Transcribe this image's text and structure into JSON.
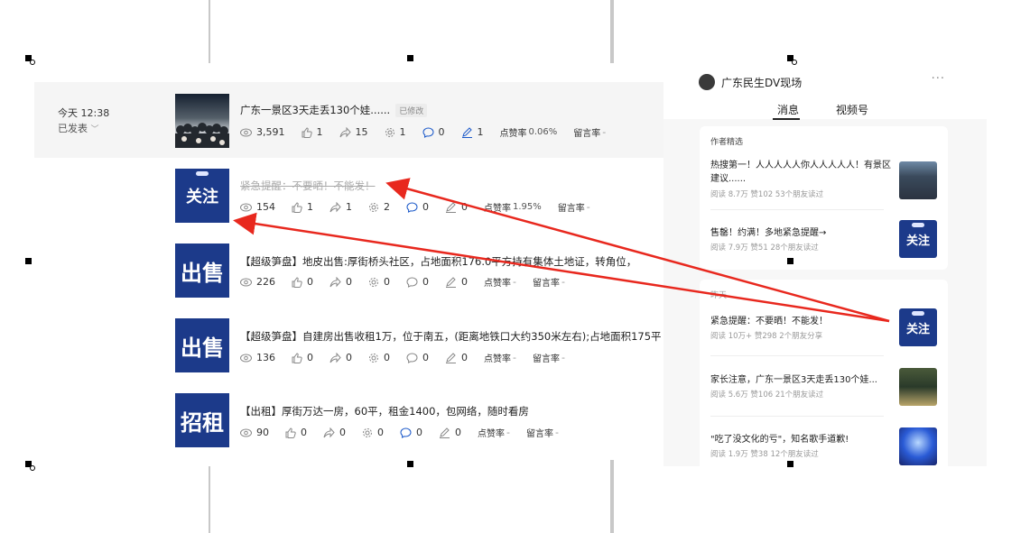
{
  "left": {
    "date": {
      "time": "今天 12:38",
      "status": "已发表"
    },
    "rows": [
      {
        "title": "广东一景区3天走丢130个娃......",
        "tag": "已修改",
        "views": "3,591",
        "likes": "1",
        "shares": "15",
        "recs": "1",
        "comments": "0",
        "edits": "1",
        "ctr_label": "点赞率",
        "ctr": "0.06%",
        "msg_label": "留言率",
        "msg": "-"
      },
      {
        "title": "紧急提醒：不要晒！不能发！",
        "views": "154",
        "likes": "1",
        "shares": "1",
        "recs": "2",
        "comments": "0",
        "edits": "0",
        "ctr_label": "点赞率",
        "ctr": "1.95%",
        "msg_label": "留言率",
        "msg": "-",
        "thumb": "关注"
      },
      {
        "title": "【超级笋盘】地皮出售:厚街桥头社区，占地面积176.0平方持有集体土地证，转角位，",
        "views": "226",
        "likes": "0",
        "shares": "0",
        "recs": "0",
        "comments": "0",
        "edits": "0",
        "ctr_label": "点赞率",
        "ctr": "-",
        "msg_label": "留言率",
        "msg": "-",
        "thumb": "出售"
      },
      {
        "title": "【超级笋盘】自建房出售收租1万，位于南五，(距离地铁口大约350米左右);占地面积175平",
        "views": "136",
        "likes": "0",
        "shares": "0",
        "recs": "0",
        "comments": "0",
        "edits": "0",
        "ctr_label": "点赞率",
        "ctr": "-",
        "msg_label": "留言率",
        "msg": "-",
        "thumb": "出售"
      },
      {
        "title": "【出租】厚街万达一房，60平，租金1400，包网络，随时看房",
        "views": "90",
        "likes": "0",
        "shares": "0",
        "recs": "0",
        "comments": "0",
        "edits": "0",
        "ctr_label": "点赞率",
        "ctr": "-",
        "msg_label": "留言率",
        "msg": "-",
        "thumb": "招租"
      }
    ]
  },
  "right": {
    "account": "广东民生DV现场",
    "more": "···",
    "tabs": [
      "消息",
      "视频号"
    ],
    "featured_header": "作者精选",
    "featured": [
      {
        "title": "热搜第一！人人人人人你人人人人人！有景区建议......",
        "meta": "阅读 8.7万  赞102  53个朋友读过"
      },
      {
        "title": "售罄！约满！多地紧急提醒→",
        "meta": "阅读 7.9万  赞51  28个朋友读过",
        "thumb": "关注"
      }
    ],
    "today_header": "昨天",
    "today": [
      {
        "title": "紧急提醒：不要晒！不能发！",
        "meta": "阅读 10万+  赞298  2个朋友分享",
        "thumb": "关注"
      },
      {
        "title": "家长注意，广东一景区3天走丢130个娃...",
        "meta": "阅读 5.6万  赞106  21个朋友读过"
      },
      {
        "title": "\"吃了没文化的亏\"，知名歌手道歉!",
        "meta": "阅读 1.9万  赞38  12个朋友读过"
      }
    ]
  },
  "colors": {
    "arrow": "#e8281e",
    "brand_blue": "#1c3a8a"
  }
}
